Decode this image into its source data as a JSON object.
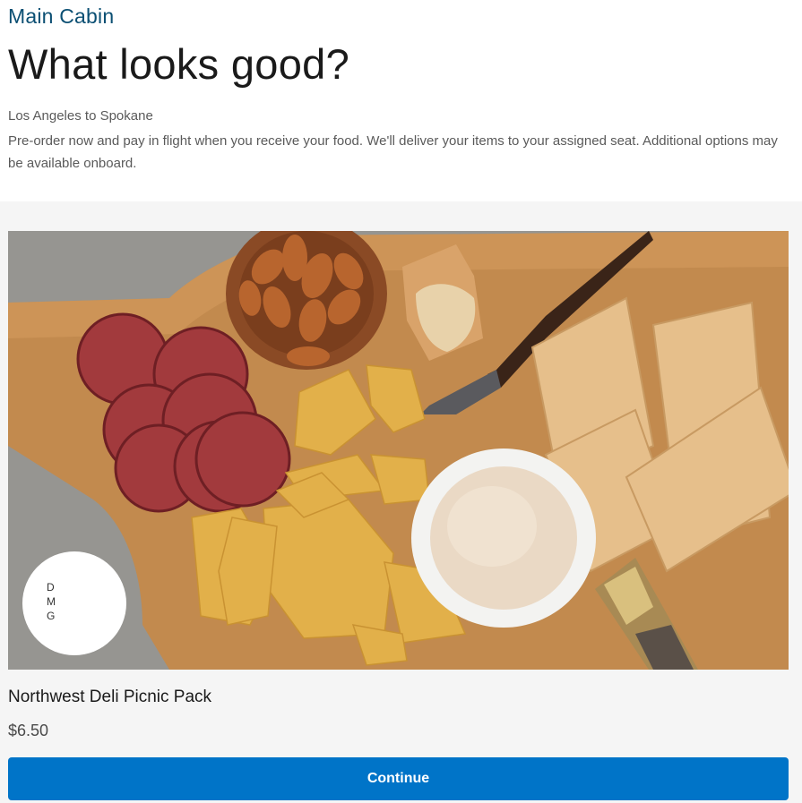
{
  "header": {
    "cabin_label": "Main Cabin",
    "title": "What looks good?",
    "route": "Los Angeles to Spokane",
    "description": "Pre-order now and pay in flight when you receive your food. We'll deliver your items to your assigned seat. Additional options may be available onboard."
  },
  "product": {
    "image_icon": "food-photo-deli-board",
    "badge_letters": [
      "D",
      "M",
      "G"
    ],
    "name": "Northwest Deli Picnic Pack",
    "price": "$6.50"
  },
  "actions": {
    "continue_label": "Continue",
    "continue_color": "#0074c8"
  },
  "colors": {
    "cabin_label": "#0b4f73",
    "content_background": "#f5f5f5"
  }
}
